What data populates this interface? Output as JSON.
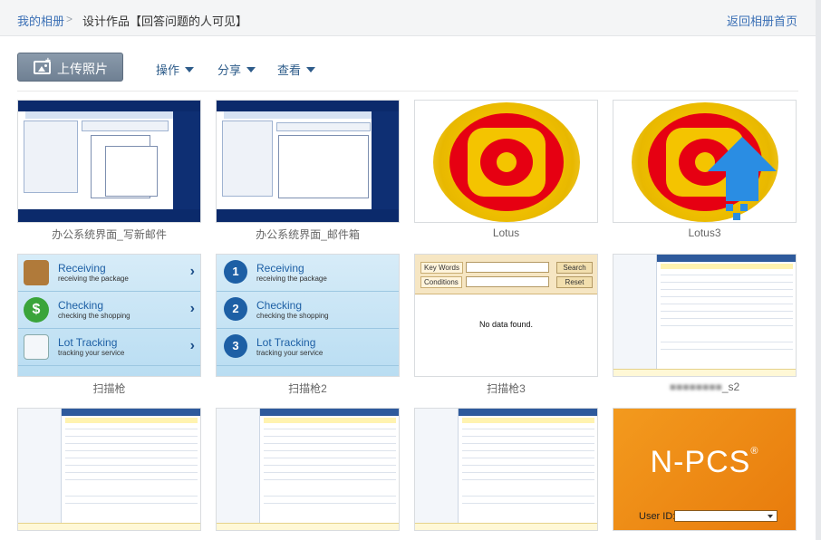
{
  "breadcrumb": {
    "home": "我的相册",
    "separator": ">",
    "current": "设计作品【回答问题的人可见】"
  },
  "back_link": "返回相册首页",
  "toolbar": {
    "upload_label": "上传照片",
    "upload_icon": "add-photo-icon",
    "menus": [
      {
        "label": "操作",
        "icon": "caret-down-icon"
      },
      {
        "label": "分享",
        "icon": "caret-down-icon"
      },
      {
        "label": "查看",
        "icon": "caret-down-icon"
      }
    ]
  },
  "photos": [
    {
      "caption": "办公系统界面_写新邮件"
    },
    {
      "caption": "办公系统界面_邮件箱"
    },
    {
      "caption": "Lotus"
    },
    {
      "caption": "Lotus3"
    },
    {
      "caption": "扫描枪"
    },
    {
      "caption": "扫描枪2"
    },
    {
      "caption": "扫描枪3"
    },
    {
      "caption": "_s2",
      "blurred_prefix": true
    }
  ],
  "thumb_scanner": {
    "rows": [
      {
        "title": "Receiving",
        "sub": "receiving the package"
      },
      {
        "title": "Checking",
        "sub": "checking the shopping"
      },
      {
        "title": "Lot Tracking",
        "sub": "tracking your service"
      }
    ],
    "numbers": [
      "1",
      "2",
      "3"
    ]
  },
  "thumb_search": {
    "key_words_label": "Key Words",
    "conditions_label": "Conditions",
    "search_button": "Search",
    "reset_button": "Reset",
    "empty_message": "No data found."
  },
  "thumb_npcs": {
    "logo": "N-PCS",
    "registered": "®",
    "user_id_label": "User ID:"
  },
  "colors": {
    "link": "#3a6fb5",
    "upload_button": "#7b8b9d",
    "menu_text": "#2e5c8a"
  }
}
